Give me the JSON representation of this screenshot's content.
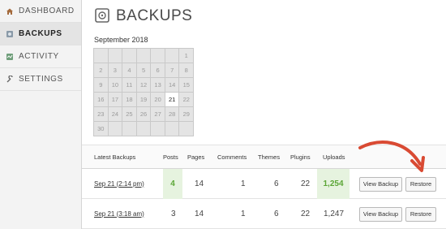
{
  "sidebar": {
    "items": [
      {
        "label": "Dashboard",
        "icon": "home-icon"
      },
      {
        "label": "Backups",
        "icon": "backups-icon"
      },
      {
        "label": "Activity",
        "icon": "activity-icon"
      },
      {
        "label": "Settings",
        "icon": "wrench-icon"
      }
    ],
    "active_index": 1
  },
  "header": {
    "title": "BACKUPS",
    "icon": "vault-icon"
  },
  "calendar": {
    "month": "September 2018",
    "weeks": [
      [
        "",
        "",
        "",
        "",
        "",
        "",
        "1"
      ],
      [
        "2",
        "3",
        "4",
        "5",
        "6",
        "7",
        "8"
      ],
      [
        "9",
        "10",
        "11",
        "12",
        "13",
        "14",
        "15"
      ],
      [
        "16",
        "17",
        "18",
        "19",
        "20",
        "21",
        "22"
      ],
      [
        "23",
        "24",
        "25",
        "26",
        "27",
        "28",
        "29"
      ],
      [
        "30",
        "",
        "",
        "",
        "",
        "",
        ""
      ]
    ],
    "selected_day": "21"
  },
  "table": {
    "headers": {
      "latest": "Latest Backups",
      "posts": "Posts",
      "pages": "Pages",
      "comments": "Comments",
      "themes": "Themes",
      "plugins": "Plugins",
      "uploads": "Uploads"
    },
    "rows": [
      {
        "date": "Sep 21 (2:14 pm)",
        "posts": "4",
        "pages": "14",
        "comments": "1",
        "themes": "6",
        "plugins": "22",
        "uploads": "1,254",
        "view": "View Backup",
        "restore": "Restore"
      },
      {
        "date": "Sep 21 (3:18 am)",
        "posts": "3",
        "pages": "14",
        "comments": "1",
        "themes": "6",
        "plugins": "22",
        "uploads": "1,247",
        "view": "View Backup",
        "restore": "Restore"
      }
    ]
  },
  "colors": {
    "highlight_bg": "#e6f3df",
    "highlight_text": "#5ba636",
    "arrow": "#d94a33",
    "sidebar_bg": "#f3f3f3"
  }
}
